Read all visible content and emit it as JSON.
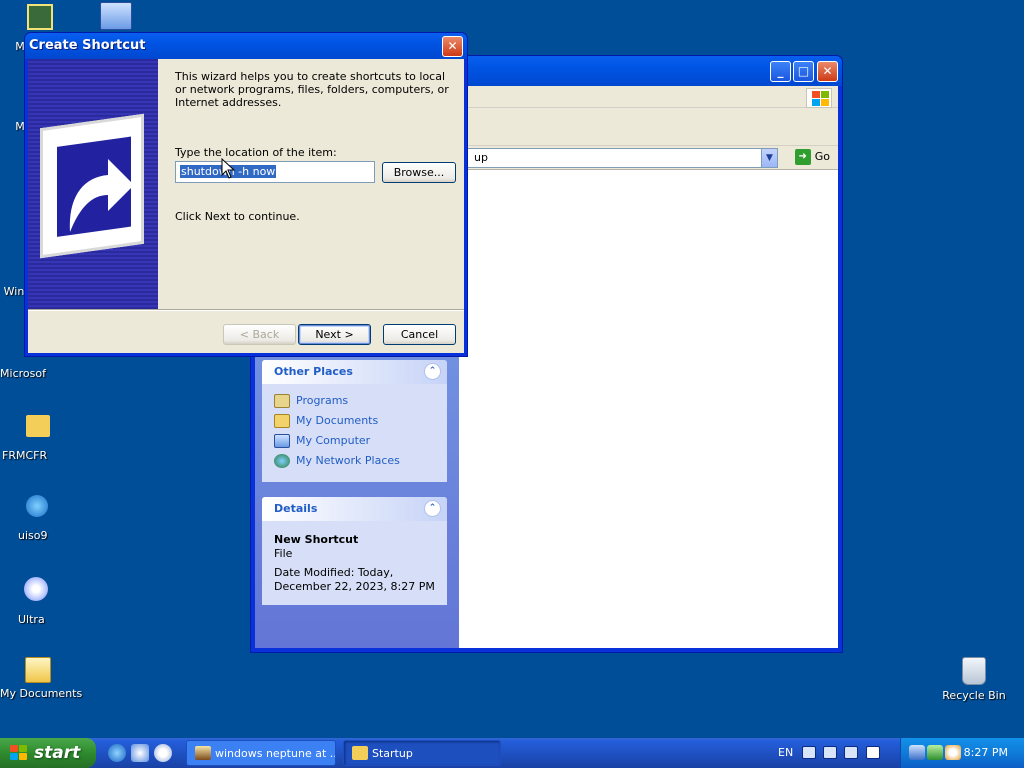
{
  "desktop": {
    "icons": [
      {
        "label": "M"
      },
      {
        "label": "M"
      },
      {
        "label": "Win"
      },
      {
        "label": "Microsof"
      },
      {
        "label": "FRMCFR"
      },
      {
        "label": "uiso9"
      },
      {
        "label": "Ultra"
      },
      {
        "label": "My Documents"
      },
      {
        "label": "Recycle Bin"
      }
    ]
  },
  "explorer": {
    "address_value": "up",
    "go_label": "Go",
    "other_places": {
      "title": "Other Places",
      "items": [
        "Programs",
        "My Documents",
        "My Computer",
        "My Network Places"
      ]
    },
    "details": {
      "title": "Details",
      "name": "New Shortcut",
      "type": "File",
      "modified_line1": "Date Modified: Today,",
      "modified_line2": "December 22, 2023, 8:27 PM"
    }
  },
  "dialog": {
    "title": "Create Shortcut",
    "intro": "This wizard helps you to create shortcuts to local or network programs, files, folders, computers, or Internet addresses.",
    "location_label": "Type the location of the item:",
    "location_value": "shutdown -h now",
    "browse_label": "Browse...",
    "hint": "Click Next to continue.",
    "back_label": "< Back",
    "next_label": "Next >",
    "cancel_label": "Cancel"
  },
  "taskbar": {
    "start_label": "start",
    "items": [
      {
        "label": "windows neptune at ..."
      },
      {
        "label": "Startup"
      }
    ],
    "language": "EN",
    "clock": "8:27 PM"
  }
}
